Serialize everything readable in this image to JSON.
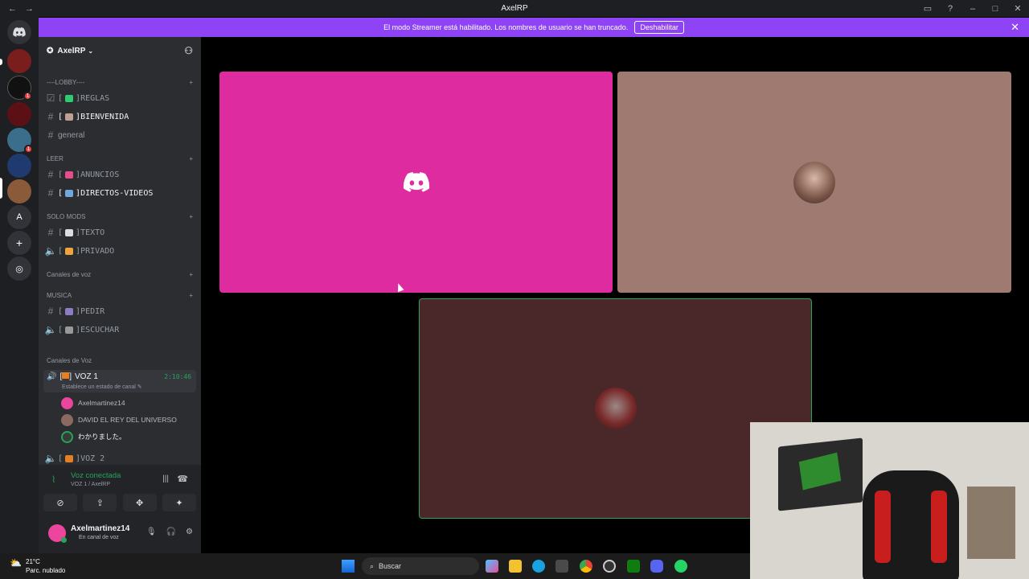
{
  "window": {
    "title": "AxelRP",
    "back": "←",
    "forward": "→"
  },
  "banner": {
    "text": "El modo Streamer está habilitado. Los nombres de usuario se han truncado.",
    "button": "Deshabilitar",
    "close": "✕"
  },
  "server": {
    "name": "AxelRP"
  },
  "categories": {
    "lobby": "----LOBBY----",
    "leer": "LEER",
    "solo_mods": "SOLO MODS",
    "canales_voz": "Canales de voz",
    "musica": "MUSICA",
    "canales_voz2": "Canales de Voz"
  },
  "channels": {
    "reglas": "REGLAS",
    "bienvenida": "BIENVENIDA",
    "general": "general",
    "anuncios": "ANUNCIOS",
    "directos": "DIRECTOS-VIDEOS",
    "texto": "TEXTO",
    "privado": "PRIVADO",
    "pedir": "PEDIR",
    "escuchar": "ESCUCHAR",
    "voz1": "VOZ 1",
    "voz2": "VOZ 2"
  },
  "voice_active": {
    "time": "2:10:46",
    "status": "Establece un estado de canal"
  },
  "members": [
    "Axelmartinez14",
    "DAVID EL REY DEL UNIVERSO",
    "わかりました。"
  ],
  "voice_panel": {
    "title": "Voz conectada",
    "sub": "VOZ 1 / AxelRP"
  },
  "user": {
    "name": "Axelmartinez14",
    "status": "En canal de voz"
  },
  "taskbar": {
    "temp": "21°C",
    "weather": "Parc. nublado",
    "search": "Buscar"
  },
  "colors": {
    "accent": "#8e44f5",
    "tile1": "#df2ba0",
    "tile2": "#9f7a70",
    "tile3": "#4a282a",
    "speaking": "#23a55a"
  }
}
